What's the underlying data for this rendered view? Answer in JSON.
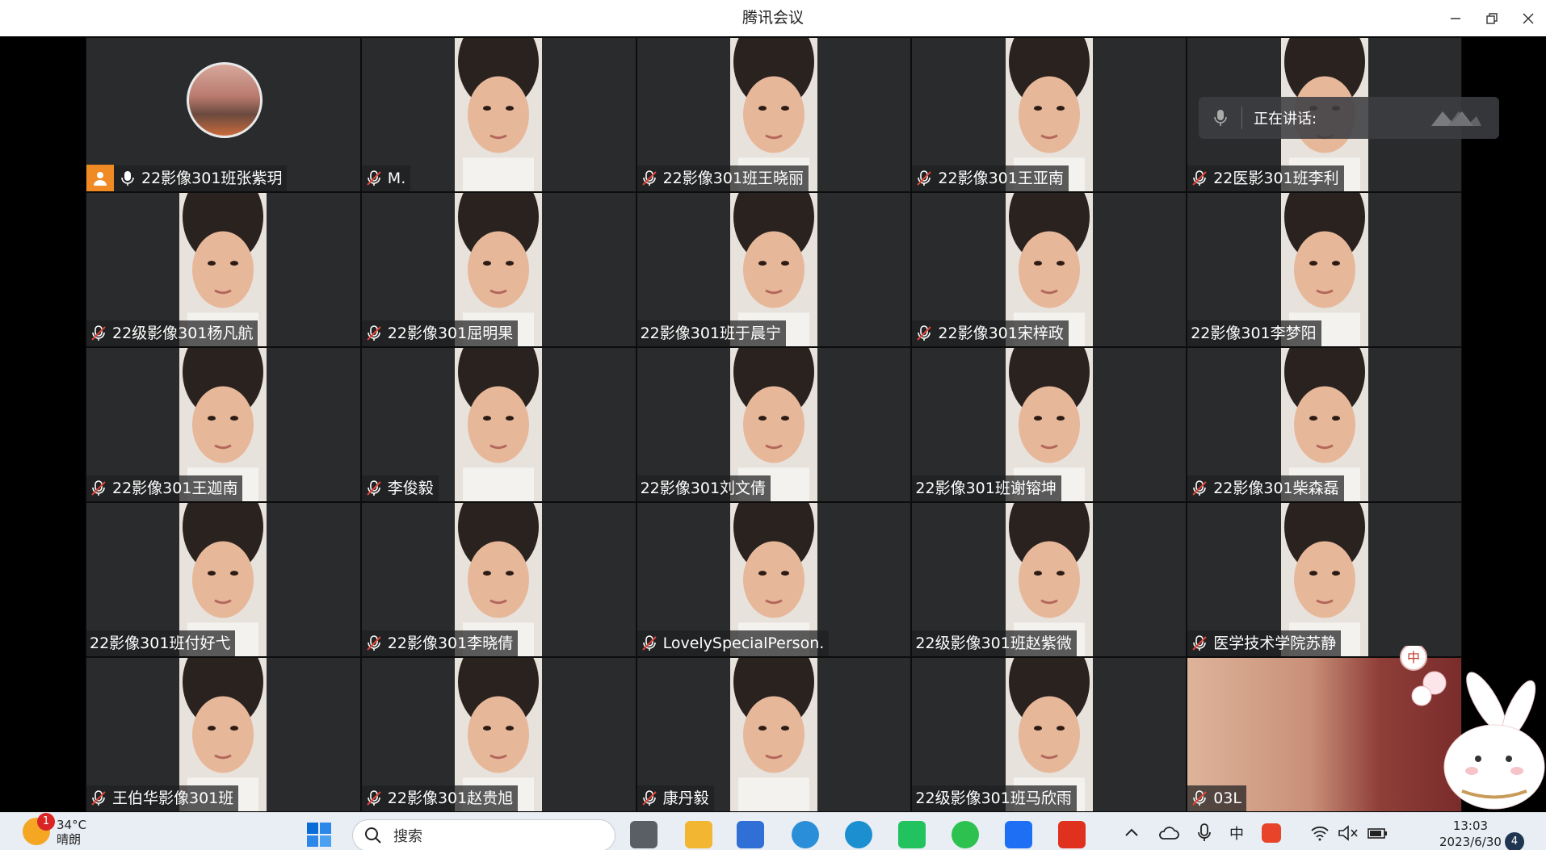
{
  "window": {
    "title": "腾讯会议"
  },
  "speaking": {
    "label": "正在讲话:"
  },
  "tiles": [
    {
      "name": "22影像301班张紫玥",
      "mic": "on",
      "host": true,
      "avatar": true
    },
    {
      "name": "M.",
      "mic": "muted"
    },
    {
      "name": "22影像301班王晓丽",
      "mic": "muted"
    },
    {
      "name": "22影像301王亚南",
      "mic": "muted"
    },
    {
      "name": "22医影301班李利",
      "mic": "muted"
    },
    {
      "name": "22级影像301杨凡航",
      "mic": "muted"
    },
    {
      "name": "22影像301屈明果",
      "mic": "muted"
    },
    {
      "name": "22影像301班于晨宁",
      "mic": "none"
    },
    {
      "name": "22影像301宋梓政",
      "mic": "muted"
    },
    {
      "name": "22影像301李梦阳",
      "mic": "none"
    },
    {
      "name": "22影像301王迦南",
      "mic": "muted"
    },
    {
      "name": "李俊毅",
      "mic": "muted"
    },
    {
      "name": "22影像301刘文倩",
      "mic": "none"
    },
    {
      "name": "22影像301班谢镕坤",
      "mic": "none"
    },
    {
      "name": "22影像301柴森磊",
      "mic": "muted"
    },
    {
      "name": "22影像301班付好弋",
      "mic": "none"
    },
    {
      "name": "22影像301李晓倩",
      "mic": "muted"
    },
    {
      "name": "LovelySpecialPerson.",
      "mic": "muted"
    },
    {
      "name": "22级影像301班赵紫微",
      "mic": "none"
    },
    {
      "name": "医学技术学院苏静",
      "mic": "muted"
    },
    {
      "name": "王伯华影像301班",
      "mic": "muted"
    },
    {
      "name": "22影像301赵贵旭",
      "mic": "muted"
    },
    {
      "name": "康丹毅",
      "mic": "muted"
    },
    {
      "name": "22级影像301班马欣雨",
      "mic": "none"
    },
    {
      "name": "03L",
      "mic": "muted",
      "self": true
    }
  ],
  "taskbar": {
    "weather": {
      "badge": "1",
      "temp": "34°C",
      "condition": "晴朗"
    },
    "search_placeholder": "搜索",
    "ime": "中",
    "clock": {
      "time": "13:03",
      "date": "2023/6/30"
    },
    "notifications": "4"
  },
  "sticker": {
    "ime_bubble": "中"
  }
}
